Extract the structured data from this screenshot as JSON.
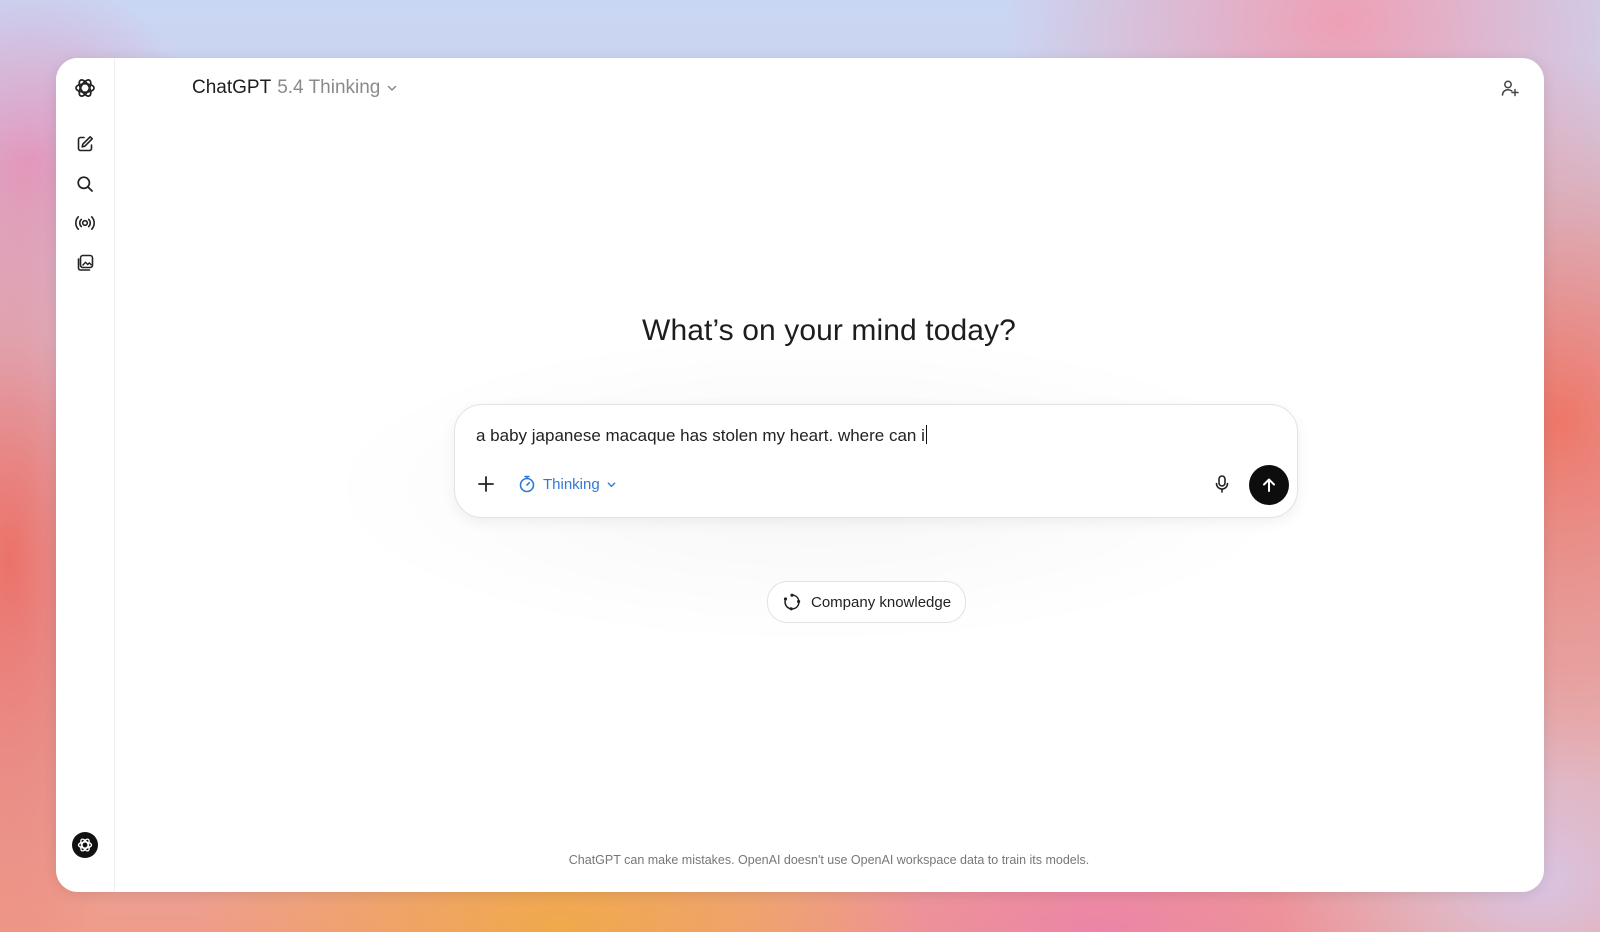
{
  "header": {
    "model_name": "ChatGPT",
    "model_version": "5.4 Thinking"
  },
  "sidebar": {
    "items": [
      {
        "icon": "openai-logo-icon"
      },
      {
        "icon": "new-chat-icon"
      },
      {
        "icon": "search-icon"
      },
      {
        "icon": "voice-icon"
      },
      {
        "icon": "images-icon"
      }
    ],
    "profile_icon": "profile-avatar-icon"
  },
  "main": {
    "headline": "What’s on your mind today?",
    "composer": {
      "value": "a baby japanese macaque has stolen my heart. where can i",
      "mode_label": "Thinking"
    },
    "suggestion_chip": "Company knowledge",
    "footer": "ChatGPT can make mistakes. OpenAI doesn't use OpenAI workspace data to train its models."
  },
  "colors": {
    "accent": "#2f7ad6",
    "send_button": "#0d0d0d",
    "text": "#1d1d1d"
  }
}
